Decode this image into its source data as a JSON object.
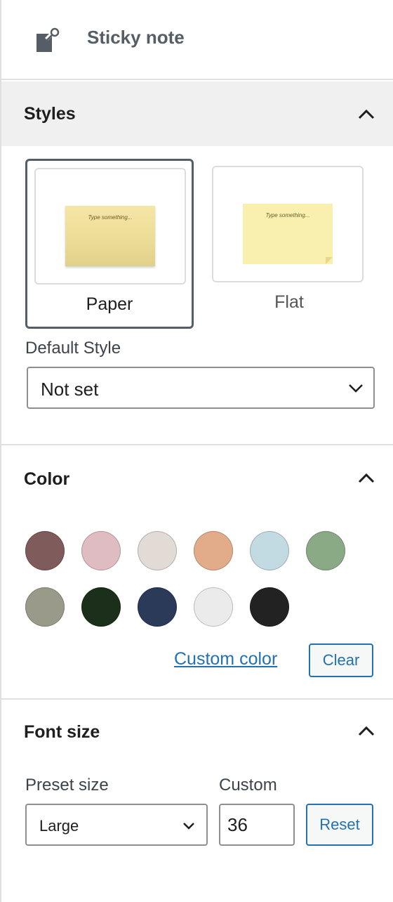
{
  "block": {
    "title": "Sticky note",
    "icon": "sticky-note-pin-icon"
  },
  "styles": {
    "title": "Styles",
    "options": [
      {
        "label": "Paper",
        "selected": true,
        "preview_text": "Type something..."
      },
      {
        "label": "Flat",
        "selected": false,
        "preview_text": "Type something..."
      }
    ],
    "default_style_label": "Default Style",
    "default_style_value": "Not set"
  },
  "color": {
    "title": "Color",
    "swatches": [
      {
        "name": "brown-swatch",
        "hex": "#7f5b5b"
      },
      {
        "name": "pink-swatch",
        "hex": "#dfbcc1"
      },
      {
        "name": "light-taupe-swatch",
        "hex": "#e2dad5"
      },
      {
        "name": "peach-swatch",
        "hex": "#e2ab8a"
      },
      {
        "name": "light-blue-swatch",
        "hex": "#c2dae1"
      },
      {
        "name": "sage-green-swatch",
        "hex": "#8aaa86"
      },
      {
        "name": "grey-green-swatch",
        "hex": "#9a9a8b"
      },
      {
        "name": "dark-green-swatch",
        "hex": "#1c2f1a"
      },
      {
        "name": "navy-swatch",
        "hex": "#2b3a58"
      },
      {
        "name": "light-grey-swatch",
        "hex": "#ebebeb"
      },
      {
        "name": "black-swatch",
        "hex": "#222222"
      }
    ],
    "custom_color_label": "Custom color",
    "clear_label": "Clear"
  },
  "font_size": {
    "title": "Font size",
    "preset_label": "Preset size",
    "preset_value": "Large",
    "custom_label": "Custom",
    "custom_value": "36",
    "reset_label": "Reset"
  }
}
